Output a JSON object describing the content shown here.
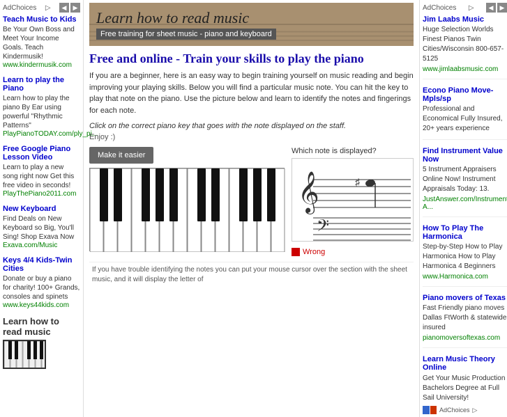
{
  "left_sidebar": {
    "ad_choices_label": "AdChoices",
    "ad_choices_symbol": "▷",
    "ads": [
      {
        "title": "Teach Music to Kids",
        "desc": "Be Your Own Boss and Meet Your Income Goals. Teach Kindermusik!",
        "url": "www.kindermusik.com"
      },
      {
        "title": "Learn to play the Piano",
        "desc": "Learn how to play the piano By Ear using powerful \"Rhythmic Patterns\"",
        "url": "PlayPianoTODAY.com/ply_pi..."
      },
      {
        "title": "Free Google Piano Lesson Video",
        "desc": "Learn to play a new song right now Get this free video in seconds!",
        "url": "PlayThePiano2011.com"
      },
      {
        "title": "New Keyboard",
        "desc": "Find Deals on New Keyboard so Big, You'll Sing! Shop Exava Now",
        "url": "Exava.com/Music"
      },
      {
        "title": "Keys 4/4 Kids-Twin Cities",
        "desc": "Donate or buy a piano for charity! 100+ Grands, consoles and spinets",
        "url": "www.keys44kids.com"
      }
    ],
    "section_title": "Learn how to read music"
  },
  "main": {
    "header_title": "Learn how to read music",
    "header_subtitle": "Free training for sheet music - piano and keyboard",
    "page_heading": "Free and online - Train your skills to play the piano",
    "intro_paragraph": "If you are a beginner, here is an easy way to begin training yourself on music reading and begin improving your playing skills. Below you will find a particular music note. You can hit the key to play that note on the piano. Use the picture below and learn to identify the notes and fingerings for each note.",
    "instruction": "Click on the correct piano key that goes with the note displayed on the staff.",
    "enjoy": "Enjoy :)",
    "make_easier_btn": "Make it easier",
    "which_note_label": "Which note is displayed?",
    "wrong_label": "Wrong"
  },
  "right_sidebar": {
    "ad_choices_label": "AdChoices",
    "ad_choices_symbol": "▷",
    "ads": [
      {
        "title": "Jim Laabs Music",
        "desc": "Huge Selection Worlds Finest Pianos Twin Cities/Wisconsin 800-657-5125",
        "url": "www.jimlaabsmusic.com"
      },
      {
        "title": "Econo Piano Move-Mpls/sp",
        "desc": "Professional and Economical Fully Insured, 20+ years experience",
        "url": ""
      },
      {
        "title": "Find Instrument Value Now",
        "desc": "5 Instrument Appraisers Online Now! Instrument Appraisals Today: 13.",
        "url": "JustAnswer.com/Instrument-A..."
      },
      {
        "title": "How To Play The Harmonica",
        "desc": "Step-by-Step How to Play Harmonica How to Play Harmonica 4 Beginners",
        "url": "www.Harmonica.com"
      },
      {
        "title": "Piano movers of Texas",
        "desc": "Fast Friendly piano moves Dallas FtWorth & statewide insured",
        "url": "pianomoversoftexas.com"
      }
    ],
    "bottom_ad_title": "Learn Music Theory Online",
    "bottom_ad_desc": "Get Your Music Production Bachelors Degree at Full Sail University!",
    "bottom_ad_choices": "AdChoices"
  },
  "footer": {
    "text": "If you have trouble identifying the notes you can put your mouse cursor over the section with the sheet music, and it will display the letter of"
  }
}
